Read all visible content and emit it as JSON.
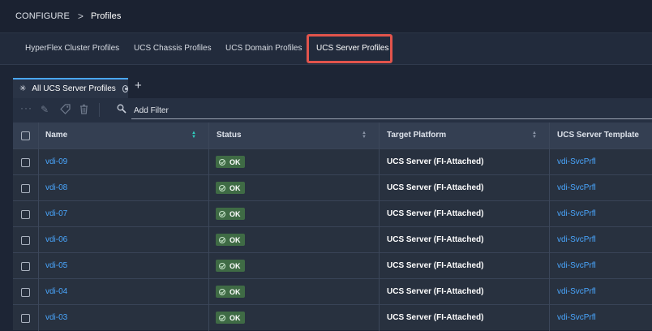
{
  "breadcrumb": {
    "root": "CONFIGURE",
    "separator": ">",
    "current": "Profiles"
  },
  "profile_tabs": [
    {
      "label": "HyperFlex Cluster Profiles",
      "active": false
    },
    {
      "label": "UCS Chassis Profiles",
      "active": false
    },
    {
      "label": "UCS Domain Profiles",
      "active": false
    },
    {
      "label": "UCS Server Profiles",
      "active": true
    }
  ],
  "highlight_color": "#e2544c",
  "view_tab": {
    "label": "All UCS Server Profiles",
    "add_symbol": "+"
  },
  "toolbar": {
    "filter_placeholder": "Add Filter"
  },
  "table": {
    "columns": [
      "Name",
      "Status",
      "Target Platform",
      "UCS Server Template"
    ],
    "rows": [
      {
        "name": "vdi-09",
        "status": "OK",
        "platform": "UCS Server (FI-Attached)",
        "template": "vdi-SvcPrfl"
      },
      {
        "name": "vdi-08",
        "status": "OK",
        "platform": "UCS Server (FI-Attached)",
        "template": "vdi-SvcPrfl"
      },
      {
        "name": "vdi-07",
        "status": "OK",
        "platform": "UCS Server (FI-Attached)",
        "template": "vdi-SvcPrfl"
      },
      {
        "name": "vdi-06",
        "status": "OK",
        "platform": "UCS Server (FI-Attached)",
        "template": "vdi-SvcPrfl"
      },
      {
        "name": "vdi-05",
        "status": "OK",
        "platform": "UCS Server (FI-Attached)",
        "template": "vdi-SvcPrfl"
      },
      {
        "name": "vdi-04",
        "status": "OK",
        "platform": "UCS Server (FI-Attached)",
        "template": "vdi-SvcPrfl"
      },
      {
        "name": "vdi-03",
        "status": "OK",
        "platform": "UCS Server (FI-Attached)",
        "template": "vdi-SvcPrfl"
      }
    ]
  },
  "colors": {
    "accent": "#4aa7ff",
    "ok_badge": "#3f6b45",
    "background": "#1d2535"
  }
}
